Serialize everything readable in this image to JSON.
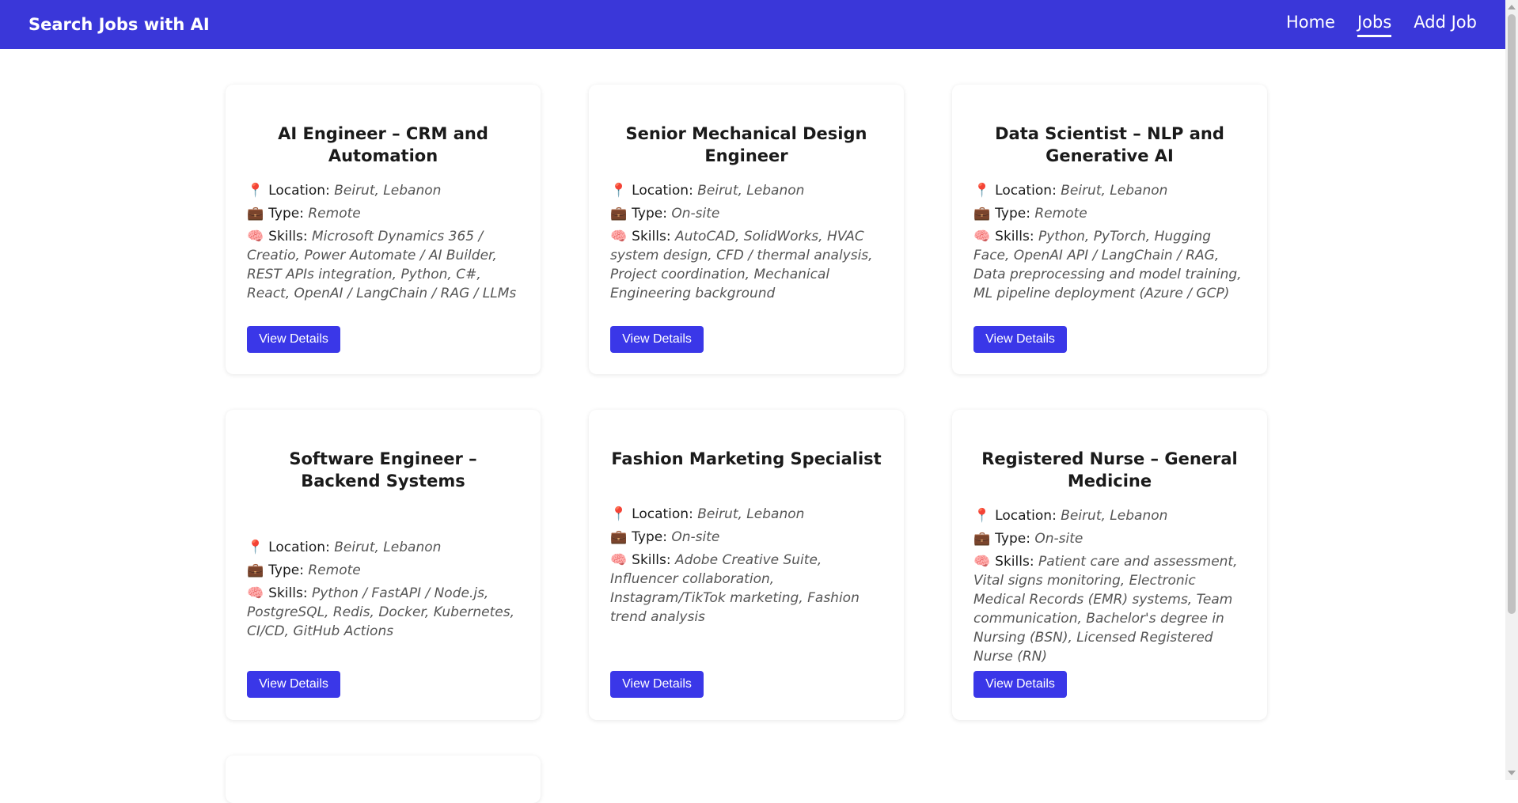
{
  "brand": "Search Jobs with AI",
  "nav": [
    {
      "label": "Home",
      "active": false
    },
    {
      "label": "Jobs",
      "active": true
    },
    {
      "label": "Add Job",
      "active": false
    }
  ],
  "field_labels": {
    "location": "Location:",
    "type": "Type:",
    "skills": "Skills:"
  },
  "field_icons": {
    "location": "pushpin",
    "type": "briefcase",
    "skills": "brain"
  },
  "view_details_label": "View Details",
  "jobs": [
    {
      "title": "AI Engineer – CRM and Automation",
      "location": "Beirut, Lebanon",
      "type": "Remote",
      "skills": "Microsoft Dynamics 365 / Creatio, Power Automate / AI Builder, REST APIs integration, Python, C#, React, OpenAI / LangChain / RAG / LLMs"
    },
    {
      "title": "Senior Mechanical Design Engineer",
      "location": "Beirut, Lebanon",
      "type": "On-site",
      "skills": "AutoCAD, SolidWorks, HVAC system design, CFD / thermal analysis, Project coordination, Mechanical Engineering background"
    },
    {
      "title": "Data Scientist – NLP and Generative AI",
      "location": "Beirut, Lebanon",
      "type": "Remote",
      "skills": "Python, PyTorch, Hugging Face, OpenAI API / LangChain / RAG, Data preprocessing and model training, ML pipeline deployment (Azure / GCP)"
    },
    {
      "title": "Software Engineer – Backend Systems",
      "location": "Beirut, Lebanon",
      "type": "Remote",
      "skills": "Python / FastAPI / Node.js, PostgreSQL, Redis, Docker, Kubernetes, CI/CD, GitHub Actions"
    },
    {
      "title": "Fashion Marketing Specialist",
      "location": "Beirut, Lebanon",
      "type": "On-site",
      "skills": "Adobe Creative Suite, Influencer collaboration, Instagram/TikTok marketing, Fashion trend analysis"
    },
    {
      "title": "Registered Nurse – General Medicine",
      "location": "Beirut, Lebanon",
      "type": "On-site",
      "skills": "Patient care and assessment, Vital signs monitoring, Electronic Medical Records (EMR) systems, Team communication, Bachelor's degree in Nursing (BSN), Licensed Registered Nurse (RN)"
    }
  ],
  "colors": {
    "navbar": "#3a37d9",
    "button": "#3a37e8"
  }
}
